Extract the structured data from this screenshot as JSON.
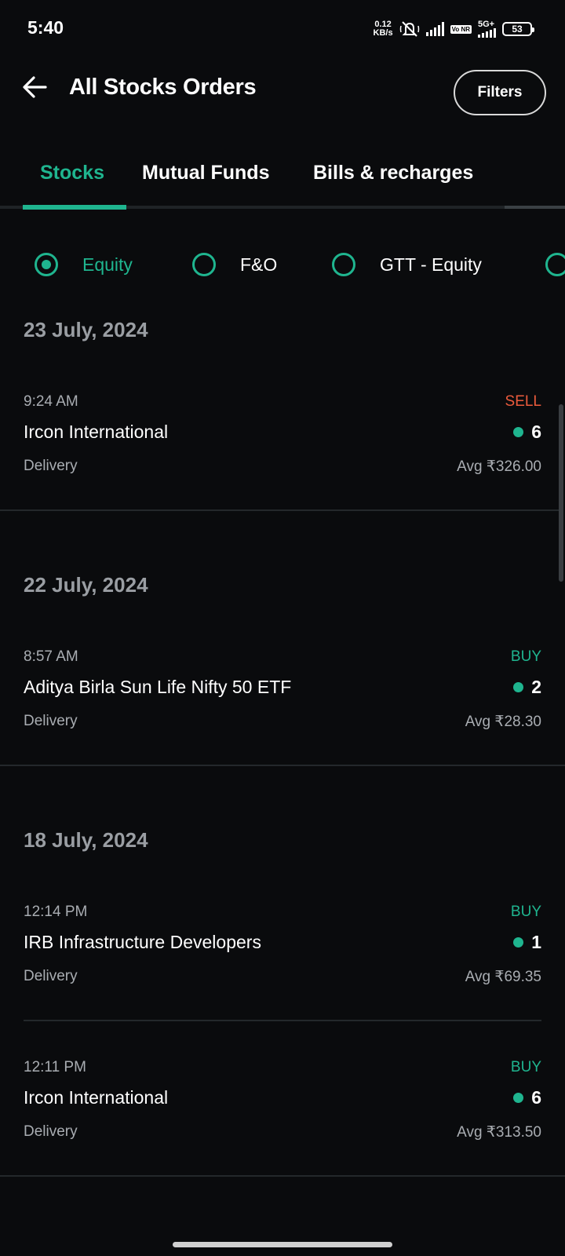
{
  "status_bar": {
    "time": "5:40",
    "net_speed_value": "0.12",
    "net_speed_unit": "KB/s",
    "volte": "Vo NR",
    "network": "5G+",
    "battery": "53"
  },
  "header": {
    "title": "All Stocks Orders",
    "filters_label": "Filters"
  },
  "tabs": [
    {
      "label": "Stocks",
      "active": true
    },
    {
      "label": "Mutual Funds",
      "active": false
    },
    {
      "label": "Bills & recharges",
      "active": false
    }
  ],
  "segments": [
    {
      "label": "Equity",
      "selected": true
    },
    {
      "label": "F&O",
      "selected": false
    },
    {
      "label": "GTT - Equity",
      "selected": false
    }
  ],
  "order_groups": [
    {
      "date": "23 July, 2024",
      "orders": [
        {
          "time": "9:24 AM",
          "side": "SELL",
          "name": "Ircon International",
          "qty": "6",
          "product": "Delivery",
          "avg": "Avg ₹326.00"
        }
      ]
    },
    {
      "date": "22 July, 2024",
      "orders": [
        {
          "time": "8:57 AM",
          "side": "BUY",
          "name": "Aditya Birla Sun Life Nifty 50 ETF",
          "qty": "2",
          "product": "Delivery",
          "avg": "Avg ₹28.30"
        }
      ]
    },
    {
      "date": "18 July, 2024",
      "orders": [
        {
          "time": "12:14 PM",
          "side": "BUY",
          "name": "IRB Infrastructure Developers",
          "qty": "1",
          "product": "Delivery",
          "avg": "Avg ₹69.35"
        },
        {
          "time": "12:11 PM",
          "side": "BUY",
          "name": "Ircon International",
          "qty": "6",
          "product": "Delivery",
          "avg": "Avg ₹313.50"
        }
      ]
    }
  ],
  "colors": {
    "accent": "#1fb58f",
    "sell": "#eb5b3c",
    "background": "#0a0b0d"
  }
}
